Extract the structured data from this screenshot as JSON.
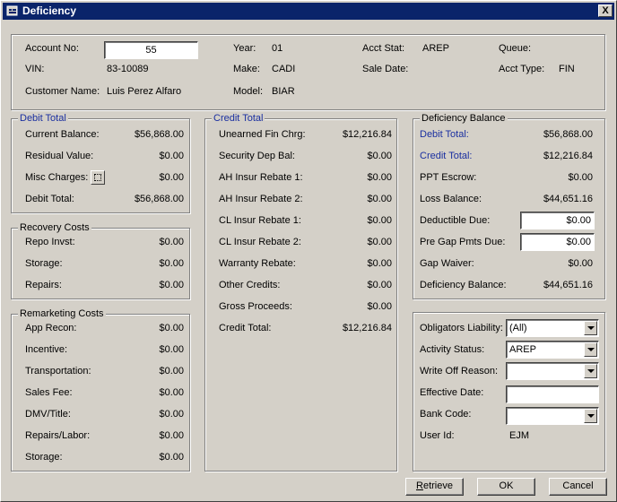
{
  "window": {
    "title": "Deficiency",
    "close_label": "X"
  },
  "header": {
    "account_no_label": "Account No:",
    "account_no": "55",
    "vin_label": "VIN:",
    "vin": "83-10089",
    "customer_name_label": "Customer Name:",
    "customer_name": "Luis Perez Alfaro",
    "year_label": "Year:",
    "year": "01",
    "make_label": "Make:",
    "make": "CADI",
    "model_label": "Model:",
    "model": "BIAR",
    "acct_stat_label": "Acct Stat:",
    "acct_stat": "AREP",
    "sale_date_label": "Sale Date:",
    "sale_date": "",
    "queue_label": "Queue:",
    "queue": "",
    "acct_type_label": "Acct Type:",
    "acct_type": "FIN"
  },
  "debit_total": {
    "title": "Debit Total",
    "rows": [
      {
        "label": "Current Balance:",
        "value": "$56,868.00"
      },
      {
        "label": "Residual Value:",
        "value": "$0.00"
      },
      {
        "label": "Misc Charges:",
        "value": "$0.00"
      },
      {
        "label": "Debit Total:",
        "value": "$56,868.00"
      }
    ]
  },
  "recovery_costs": {
    "title": "Recovery Costs",
    "rows": [
      {
        "label": "Repo Invst:",
        "value": "$0.00"
      },
      {
        "label": "Storage:",
        "value": "$0.00"
      },
      {
        "label": "Repairs:",
        "value": "$0.00"
      }
    ]
  },
  "remarketing_costs": {
    "title": "Remarketing Costs",
    "rows": [
      {
        "label": "App Recon:",
        "value": "$0.00"
      },
      {
        "label": "Incentive:",
        "value": "$0.00"
      },
      {
        "label": "Transportation:",
        "value": "$0.00"
      },
      {
        "label": "Sales Fee:",
        "value": "$0.00"
      },
      {
        "label": "DMV/Title:",
        "value": "$0.00"
      },
      {
        "label": "Repairs/Labor:",
        "value": "$0.00"
      },
      {
        "label": "Storage:",
        "value": "$0.00"
      }
    ]
  },
  "credit_total": {
    "title": "Credit Total",
    "rows": [
      {
        "label": "Unearned Fin Chrg:",
        "value": "$12,216.84"
      },
      {
        "label": "Security Dep Bal:",
        "value": "$0.00"
      },
      {
        "label": "AH Insur Rebate 1:",
        "value": "$0.00"
      },
      {
        "label": "AH Insur Rebate 2:",
        "value": "$0.00"
      },
      {
        "label": "CL Insur Rebate 1:",
        "value": "$0.00"
      },
      {
        "label": "CL Insur Rebate 2:",
        "value": "$0.00"
      },
      {
        "label": "Warranty Rebate:",
        "value": "$0.00"
      },
      {
        "label": "Other Credits:",
        "value": "$0.00"
      },
      {
        "label": "Gross Proceeds:",
        "value": "$0.00"
      },
      {
        "label": "Credit Total:",
        "value": "$12,216.84"
      }
    ]
  },
  "deficiency_balance": {
    "title": "Deficiency Balance",
    "debit_total_label": "Debit Total:",
    "debit_total": "$56,868.00",
    "credit_total_label": "Credit Total:",
    "credit_total": "$12,216.84",
    "ppt_escrow_label": "PPT Escrow:",
    "ppt_escrow": "$0.00",
    "loss_balance_label": "Loss Balance:",
    "loss_balance": "$44,651.16",
    "deductible_due_label": "Deductible Due:",
    "deductible_due": "$0.00",
    "pre_gap_label": "Pre Gap Pmts Due:",
    "pre_gap": "$0.00",
    "gap_waiver_label": "Gap Waiver:",
    "gap_waiver": "$0.00",
    "deficiency_balance_label": "Deficiency Balance:",
    "deficiency_balance": "$44,651.16"
  },
  "settings": {
    "obligators_label": "Obligators Liability:",
    "obligators": "(All)",
    "activity_status_label": "Activity Status:",
    "activity_status": "AREP",
    "write_off_label": "Write Off Reason:",
    "write_off": "",
    "effective_date_label": "Effective Date:",
    "effective_date": "",
    "bank_code_label": "Bank Code:",
    "bank_code": "",
    "user_id_label": "User Id:",
    "user_id": "EJM"
  },
  "buttons": {
    "retrieve_first": "R",
    "retrieve_rest": "etrieve",
    "ok": "OK",
    "cancel": "Cancel"
  },
  "colors": {
    "title_bar": "#0a246a",
    "face": "#d4d0c8",
    "label_blue": "#1a2fa0"
  }
}
